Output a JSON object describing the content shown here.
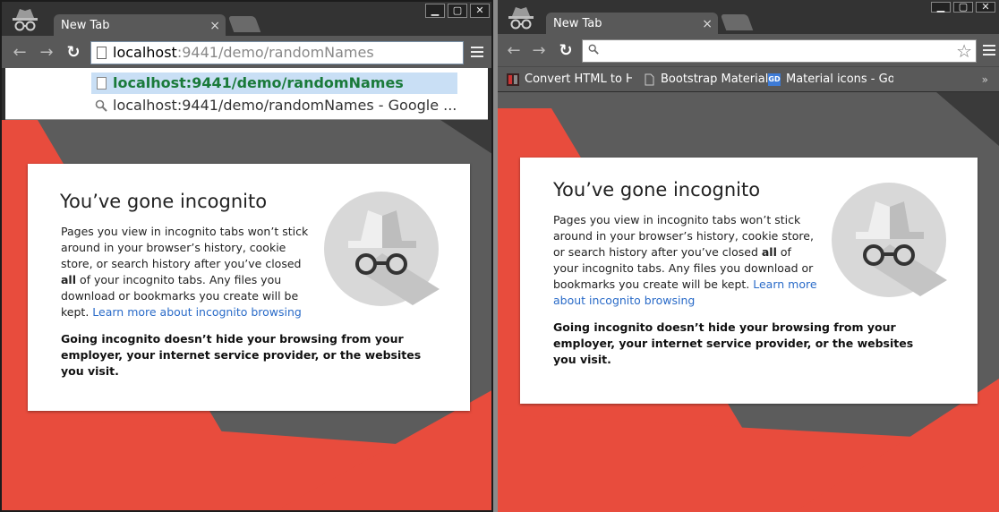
{
  "left_window": {
    "tab_title": "New Tab",
    "tab_close": "×",
    "window_controls": [
      "▁",
      "▢",
      "✕"
    ],
    "url_host": "localhost",
    "url_rest": ":9441/demo/randomNames",
    "dropdown": {
      "selected": "localhost:9441/demo/randomNames",
      "suggestion": "localhost:9441/demo/randomNames - Google ..."
    }
  },
  "right_window": {
    "tab_title": "New Tab",
    "tab_close": "×",
    "window_controls": [
      "▁",
      "▢",
      "✕"
    ],
    "omnibox_value": "",
    "bookmarks": [
      {
        "label": "Convert HTML to HA"
      },
      {
        "label": "Bootstrap Material"
      },
      {
        "label": "Material icons - Goo",
        "icon_text": "GD"
      }
    ],
    "bookmarks_more": "»"
  },
  "nav": {
    "back": "←",
    "forward": "→",
    "reload": "↻",
    "star": "☆"
  },
  "incognito": {
    "title": "You’ve gone incognito",
    "desc_part1": "Pages you view in incognito tabs won’t stick around in your browser’s history, cookie store, or search history after you’ve closed ",
    "desc_bold": "all",
    "desc_part2": " of your incognito tabs. Any files you download or bookmarks you create will be kept. ",
    "learn_more": "Learn more about incognito browsing",
    "warning": "Going incognito doesn’t hide your browsing from your employer, your internet service provider, or the websites you visit."
  },
  "colors": {
    "accent_red": "#e84c3d",
    "bg_dark": "#5c5c5c",
    "link_blue": "#2a6bc8",
    "dropdown_highlight": "#c9dff5",
    "dropdown_green": "#1a7a3a"
  }
}
